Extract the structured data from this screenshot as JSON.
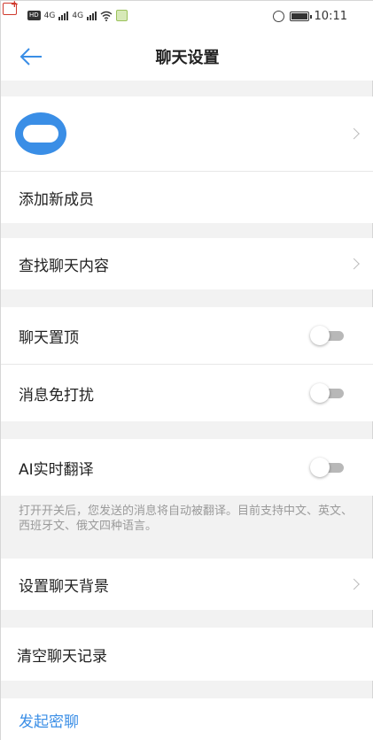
{
  "status_bar": {
    "network_badge": "HD",
    "signal1": "4G",
    "signal2": "4G",
    "time": "10:11"
  },
  "header": {
    "title": "聊天设置"
  },
  "profile": {
    "avatar_color": "#3a8ee6"
  },
  "rows": {
    "add_member": "添加新成员",
    "search_chat": "查找聊天内容",
    "pin_chat": "聊天置顶",
    "mute": "消息免打扰",
    "ai_translate": "AI实时翻译",
    "translate_hint": "打开开关后，您发送的消息将自动被翻译。目前支持中文、英文、西班牙文、俄文四种语言。",
    "set_background": "设置聊天背景",
    "clear_history": "清空聊天记录",
    "secret_chat": "发起密聊"
  },
  "toggles": {
    "pin_chat": false,
    "mute": false,
    "ai_translate": false
  },
  "colors": {
    "accent": "#3a8ee6",
    "background": "#f2f2f2",
    "toggle_off": "#b8b8b8"
  }
}
